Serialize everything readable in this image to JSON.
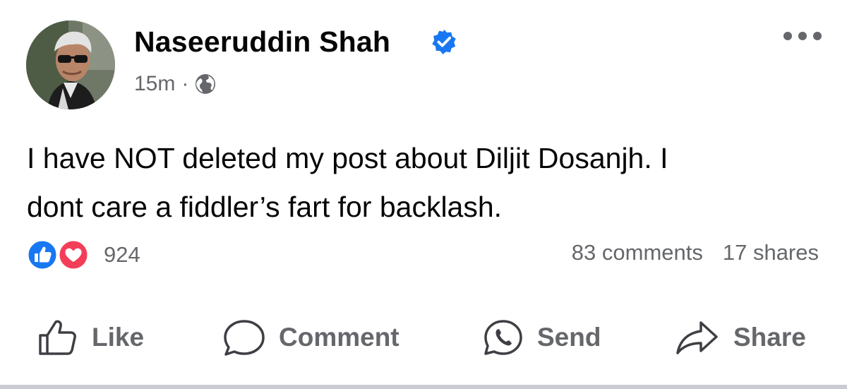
{
  "post": {
    "author": "Naseeruddin Shah",
    "timestamp": "15m",
    "separator": "·",
    "audience_icon": "globe-icon",
    "verified_icon": "verified-badge-icon",
    "text": "I have NOT deleted my post about Diljit Dosanjh. I\ndont care a fiddler’s fart for backlash."
  },
  "stats": {
    "reaction_icons": [
      "like-reaction-icon",
      "love-reaction-icon"
    ],
    "reaction_count": "924",
    "comments": "83 comments",
    "shares": "17 shares"
  },
  "actions": {
    "like": "Like",
    "comment": "Comment",
    "send": "Send",
    "share": "Share"
  },
  "colors": {
    "brand_blue": "#1877f2",
    "love_red": "#f33e58",
    "secondary_text": "#65676b",
    "primary_text": "#050505"
  }
}
